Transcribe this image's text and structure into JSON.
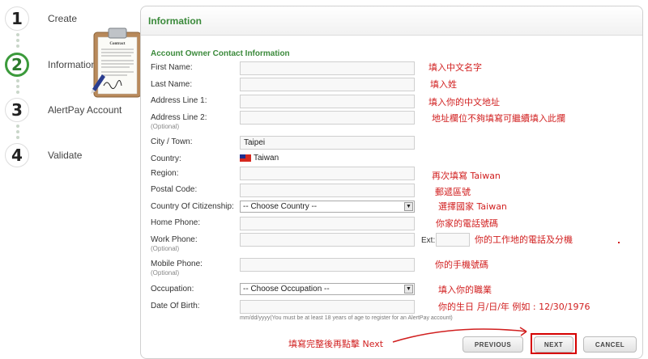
{
  "steps": [
    {
      "number": "1",
      "label": "Create"
    },
    {
      "number": "2",
      "label": "Information"
    },
    {
      "number": "3",
      "label": "AlertPay Account"
    },
    {
      "number": "4",
      "label": "Validate"
    }
  ],
  "clipboard_title": "Contract",
  "panel": {
    "title": "Information"
  },
  "form": {
    "section_title": "Account Owner Contact Information",
    "fields": {
      "first_name": {
        "label": "First Name:",
        "value": ""
      },
      "last_name": {
        "label": "Last Name:",
        "value": ""
      },
      "address1": {
        "label": "Address Line 1:",
        "value": ""
      },
      "address2": {
        "label": "Address Line 2:",
        "sub": "(Optional)",
        "value": ""
      },
      "city": {
        "label": "City / Town:",
        "value": "Taipei"
      },
      "country": {
        "label": "Country:",
        "value": "Taiwan"
      },
      "region": {
        "label": "Region:",
        "value": ""
      },
      "postal": {
        "label": "Postal Code:",
        "value": ""
      },
      "citizenship": {
        "label": "Country Of Citizenship:",
        "value": "-- Choose Country --"
      },
      "home_phone": {
        "label": "Home Phone:",
        "value": ""
      },
      "work_phone": {
        "label": "Work Phone:",
        "sub": "(Optional)",
        "value": "",
        "ext_label": "Ext:"
      },
      "mobile_phone": {
        "label": "Mobile Phone:",
        "sub": "(Optional)",
        "value": ""
      },
      "occupation": {
        "label": "Occupation:",
        "value": "-- Choose Occupation --"
      },
      "dob": {
        "label": "Date Of Birth:",
        "value": ""
      }
    },
    "dob_hint": "mm/dd/yyyy(You must be at least 18 years of age to register for an AlertPay account)"
  },
  "annotations": {
    "first_name": "填入中文名字",
    "last_name": "填入姓",
    "address1": "填入你的中文地址",
    "address2": "地址欄位不夠填寫可繼續填入此攔",
    "region": "再次填寫 Taiwan",
    "postal": "郵遞區號",
    "citizenship": "選擇國家 Taiwan",
    "home_phone": "你家的電話號碼",
    "work_phone": "你的工作地的電話及分機",
    "mobile_phone": "你的手機號碼",
    "occupation": "填入你的職業",
    "dob": "你的生日 月/日/年  例如 : 12/30/1976",
    "next": "填寫完整後再點擊 Next"
  },
  "buttons": {
    "previous": "PREVIOUS",
    "next": "NEXT",
    "cancel": "CANCEL"
  },
  "colors": {
    "accent_green": "#3b8a3b",
    "annotation_red": "#d11f1f",
    "highlight_red": "#d60000"
  }
}
